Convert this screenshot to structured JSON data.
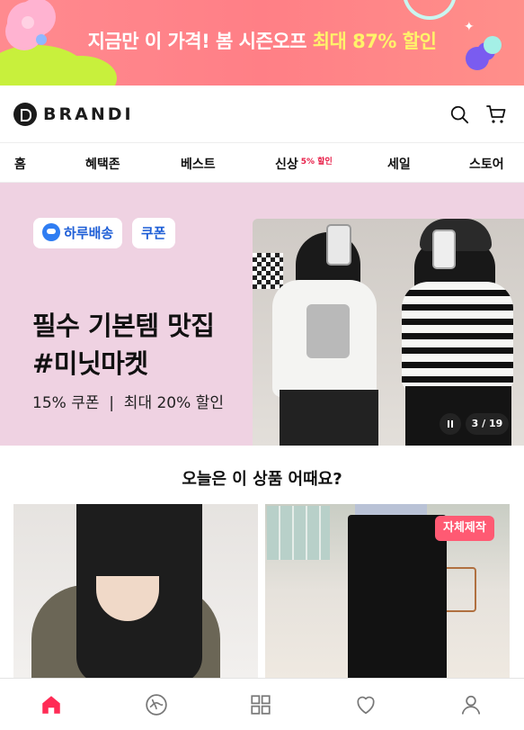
{
  "promo": {
    "text_prefix": "지금만 이 가격! 봄 시즌오프 ",
    "text_highlight": "최대 87% 할인"
  },
  "header": {
    "logo_text": "BRANDI",
    "icons": [
      "search-icon",
      "cart-icon"
    ]
  },
  "nav": {
    "items": [
      {
        "label": "홈",
        "active": true
      },
      {
        "label": "혜택존"
      },
      {
        "label": "베스트"
      },
      {
        "label": "신상",
        "badge": "5% 할인"
      },
      {
        "label": "세일"
      },
      {
        "label": "스토어"
      }
    ]
  },
  "hero": {
    "chip_delivery": "하루배송",
    "chip_coupon": "쿠폰",
    "title_line1": "필수 기본템 맛집",
    "title_line2": "#미닛마켓",
    "subtitle": "15% 쿠폰  |  최대 20% 할인",
    "counter": "3 / 19"
  },
  "recommend": {
    "title": "오늘은 이 상품 어때요?",
    "badge_self_made": "자체제작"
  },
  "tabbar": {
    "icons": [
      "home-icon",
      "style-icon",
      "category-icon",
      "heart-icon",
      "profile-icon"
    ],
    "active_color": "#ff2b55"
  },
  "colors": {
    "brand_pink": "#ff2b55",
    "hero_bg": "#efd2e2",
    "chip_blue": "#1e5ed6"
  }
}
